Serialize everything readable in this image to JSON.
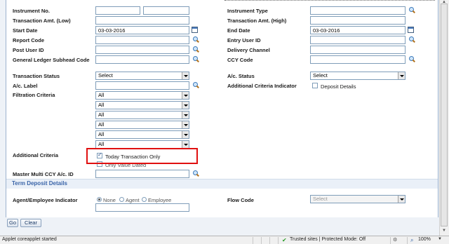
{
  "form": {
    "instrument_no": {
      "label": "Instrument No.",
      "value1": "",
      "value2": ""
    },
    "instrument_type": {
      "label": "Instrument Type",
      "value": ""
    },
    "txn_amt_low": {
      "label": "Transaction Amt. (Low)",
      "value": ""
    },
    "txn_amt_high": {
      "label": "Transaction Amt. (High)",
      "value": ""
    },
    "start_date": {
      "label": "Start Date",
      "value": "03-03-2016"
    },
    "end_date": {
      "label": "End Date",
      "value": "03-03-2016"
    },
    "report_code": {
      "label": "Report Code",
      "value": ""
    },
    "entry_user_id": {
      "label": "Entry User ID",
      "value": ""
    },
    "post_user_id": {
      "label": "Post User ID",
      "value": ""
    },
    "delivery_channel": {
      "label": "Delivery Channel",
      "value": ""
    },
    "gl_subhead_code": {
      "label": "General Ledger Subhead Code",
      "value": ""
    },
    "ccy_code": {
      "label": "CCY Code",
      "value": ""
    },
    "transaction_status": {
      "label": "Transaction Status",
      "selected": "Select"
    },
    "ac_status": {
      "label": "A/c. Status",
      "selected": "Select"
    },
    "ac_label": {
      "label": "A/c. Label",
      "value": ""
    },
    "additional_criteria_indicator": {
      "label": "Additional Criteria Indicator",
      "checkbox_label": "Deposit Details",
      "checked": false
    },
    "filtration_criteria": {
      "label": "Filtration Criteria",
      "selects": [
        "All",
        "All",
        "All",
        "All",
        "All",
        "All"
      ]
    },
    "additional_criteria": {
      "label": "Additional Criteria",
      "today_only": {
        "label": "Today Transaction Only",
        "checked": true
      },
      "value_dated": {
        "label": "Only Value Dated",
        "checked": false
      }
    },
    "master_multi_ccy": {
      "label": "Master Multi CCY A/c. ID",
      "value": ""
    }
  },
  "term_deposit": {
    "title": "Term Deposit Details",
    "agent_employee_indicator": {
      "label": "Agent/Employee Indicator",
      "options": [
        "None",
        "Agent",
        "Employee"
      ],
      "selected": "None",
      "value": ""
    },
    "flow_code": {
      "label": "Flow Code",
      "selected": "Select"
    }
  },
  "buttons": {
    "go": "Go",
    "clear": "Clear"
  },
  "statusbar": {
    "message": "Applet coreapplet started",
    "zone": "Trusted sites | Protected Mode: Off",
    "zoom": "100%"
  },
  "colors": {
    "highlight_box": "#e01010",
    "section_title": "#3a64a8"
  }
}
